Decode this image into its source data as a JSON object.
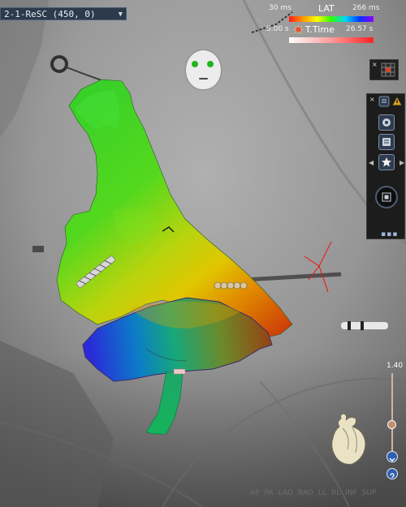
{
  "map_selector": {
    "label": "2-1-ReSC (450, 0)"
  },
  "lat_scale": {
    "title": "LAT",
    "min_label": "30 ms",
    "max_label": "266 ms",
    "gradient_colors": [
      "#ff1a1a",
      "#ff9a00",
      "#ffff00",
      "#2bff00",
      "#00d7ff",
      "#0037ff",
      "#8b00ff"
    ]
  },
  "time_scale": {
    "title": "T.Time",
    "min_label": "5.00 s",
    "max_label": "26.57 s",
    "gradient_colors": [
      "#ffffff",
      "#ff9a9a",
      "#ff2222"
    ]
  },
  "zoom": {
    "value_label": "1.40"
  },
  "view_buttons": [
    "AP",
    "PA",
    "LAO",
    "RAO",
    "LL",
    "RL",
    "INF",
    "SUP"
  ],
  "icons": {
    "face": "patient-orientation-face-icon",
    "heart": "heart-orientation-icon",
    "toolbar_settings": "settings-icon",
    "toolbar_tags": "tag-icon",
    "toolbar_star": "star-icon",
    "toolbar_reset": "reset-view-icon",
    "warning": "warning-icon"
  },
  "colors": {
    "selector_bg": "#2c3a4c",
    "toolbar_bg": "#1c1c1c",
    "zoom_thumb": "#c48d6c"
  }
}
